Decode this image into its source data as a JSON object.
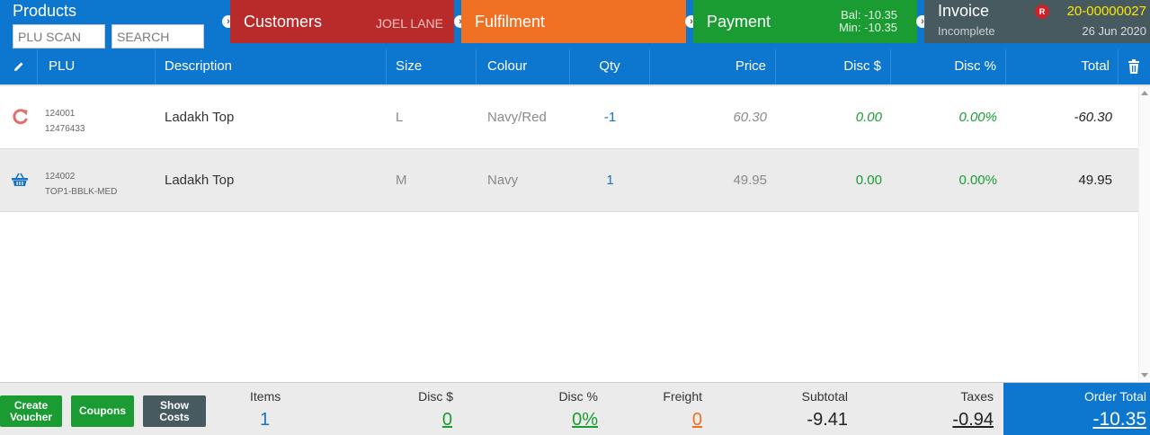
{
  "steps": {
    "products": {
      "title": "Products",
      "plu_placeholder": "PLU SCAN",
      "search_placeholder": "SEARCH"
    },
    "customers": {
      "title": "Customers",
      "customer_name": "JOEL LANE"
    },
    "fulfilment": {
      "title": "Fulfilment"
    },
    "payment": {
      "title": "Payment",
      "balance": "Bal:  -10.35",
      "minimum": "Min:  -10.35"
    },
    "invoice": {
      "title": "Invoice",
      "status": "Incomplete",
      "badge": "R",
      "number": "20-00000027",
      "date": "26 Jun 2020"
    }
  },
  "columns": {
    "plu": "PLU",
    "description": "Description",
    "size": "Size",
    "colour": "Colour",
    "qty": "Qty",
    "price": "Price",
    "disc_amount": "Disc $",
    "disc_percent": "Disc %",
    "total": "Total"
  },
  "rows": [
    {
      "icon": "return-icon",
      "plu": "124001",
      "code": "12476433",
      "description": "Ladakh Top",
      "size": "L",
      "colour": "Navy/Red",
      "qty": "-1",
      "price": "60.30",
      "disc_amount": "0.00",
      "disc_percent": "0.00%",
      "total": "-60.30",
      "italic": true
    },
    {
      "icon": "basket-icon",
      "plu": "124002",
      "code": "TOP1-BBLK-MED",
      "description": "Ladakh Top",
      "size": "M",
      "colour": "Navy",
      "qty": "1",
      "price": "49.95",
      "disc_amount": "0.00",
      "disc_percent": "0.00%",
      "total": "49.95",
      "italic": false
    }
  ],
  "footer": {
    "buttons": {
      "create_voucher": "Create Voucher",
      "coupons": "Coupons",
      "show_costs": "Show Costs"
    },
    "items": {
      "label": "Items",
      "value": "1"
    },
    "disc_amount": {
      "label": "Disc $",
      "value": "0"
    },
    "disc_percent": {
      "label": "Disc %",
      "value": "0%"
    },
    "freight": {
      "label": "Freight",
      "value": "0"
    },
    "subtotal": {
      "label": "Subtotal",
      "value": "-9.41"
    },
    "taxes": {
      "label": "Taxes",
      "value": "-0.94"
    },
    "order_total": {
      "label": "Order Total",
      "value": "-10.35"
    }
  },
  "colors": {
    "primary_blue": "#0d76cf",
    "customers_red": "#b92a2a",
    "fulfilment_orange": "#f07124",
    "payment_green": "#1b9c33",
    "invoice_slate": "#475a5f",
    "invoice_number_yellow": "#ffe500"
  }
}
